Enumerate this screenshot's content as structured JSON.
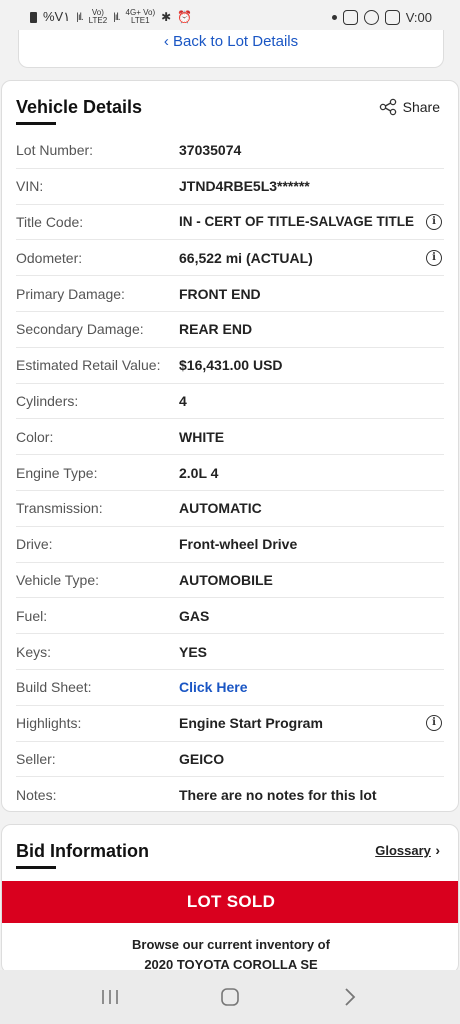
{
  "status_bar": {
    "left_text": "%V١",
    "net1_top": "Vo)",
    "net1_bottom": "LTE2",
    "net2_top": "4G+ Vo)",
    "net2_bottom": "LTE1",
    "clock": "V:00"
  },
  "top_card": {
    "back_label": "Back to Lot Details"
  },
  "vehicle_details": {
    "title": "Vehicle Details",
    "share_label": "Share",
    "rows": [
      {
        "label": "Lot Number:",
        "value": "37035074"
      },
      {
        "label": "VIN:",
        "value": "JTND4RBE5L3******"
      },
      {
        "label": "Title Code:",
        "value": "IN - CERT OF TITLE-SALVAGE TITLE"
      },
      {
        "label": "Odometer:",
        "value": "66,522 mi (ACTUAL)"
      },
      {
        "label": "Primary Damage:",
        "value": "FRONT END"
      },
      {
        "label": "Secondary Damage:",
        "value": "REAR END"
      },
      {
        "label": "Estimated Retail Value:",
        "value": "$16,431.00 USD"
      },
      {
        "label": "Cylinders:",
        "value": "4"
      },
      {
        "label": "Color:",
        "value": "WHITE"
      },
      {
        "label": "Engine Type:",
        "value": "2.0L 4"
      },
      {
        "label": "Transmission:",
        "value": "AUTOMATIC"
      },
      {
        "label": "Drive:",
        "value": "Front-wheel Drive"
      },
      {
        "label": "Vehicle Type:",
        "value": "AUTOMOBILE"
      },
      {
        "label": "Fuel:",
        "value": "GAS"
      },
      {
        "label": "Keys:",
        "value": "YES"
      },
      {
        "label": "Build Sheet:",
        "value": "Click Here"
      },
      {
        "label": "Highlights:",
        "value": "Engine Start Program"
      },
      {
        "label": "Seller:",
        "value": "GEICO"
      },
      {
        "label": "Notes:",
        "value": "There are no notes for this lot"
      }
    ]
  },
  "bid_information": {
    "title": "Bid Information",
    "glossary_label": "Glossary",
    "lot_sold_label": "LOT SOLD",
    "browse_line1": "Browse our current inventory of",
    "browse_line2": "2020 TOYOTA COROLLA SE"
  },
  "colors": {
    "accent": "#1a56c4",
    "sold_banner": "#d9001e"
  },
  "icons": [
    "back-chevron-icon",
    "share-icon",
    "info-icon",
    "chevron-right-icon",
    "recent-apps-icon",
    "home-icon",
    "back-icon"
  ]
}
